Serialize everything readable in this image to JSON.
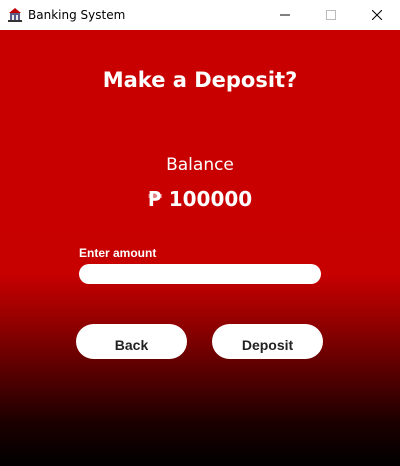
{
  "window": {
    "title": "Banking System",
    "icon": "bank-app-icon",
    "controls": [
      "minimize-icon",
      "maximize-icon",
      "close-icon"
    ]
  },
  "main": {
    "heading": "Make a Deposit?",
    "balance_label": "Balance",
    "balance_value": "₱ 100000",
    "amount_label": "Enter amount",
    "amount_value": "",
    "back_label": "Back",
    "deposit_label": "Deposit"
  },
  "colors": {
    "background_top": "#c90000",
    "background_bottom": "#000000",
    "text": "#ffffff",
    "button_bg": "#ffffff",
    "button_text": "#222222"
  }
}
